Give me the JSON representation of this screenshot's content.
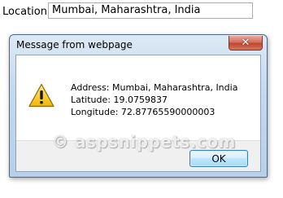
{
  "location": {
    "label": "Location:",
    "value": "Mumbai, Maharashtra, India"
  },
  "dialog": {
    "title": "Message from webpage",
    "close_glyph": "✕",
    "icon": "warning-icon",
    "message_lines": [
      "Address: Mumbai, Maharashtra, India",
      "Latitude: 19.0759837",
      "Longitude: 72.87765590000003"
    ],
    "ok_label": "OK"
  },
  "watermark": "© aspsnippets.com",
  "colors": {
    "close_button": "#c04730",
    "warning_yellow": "#f5c400",
    "ok_button_border": "#3c7fb1"
  }
}
